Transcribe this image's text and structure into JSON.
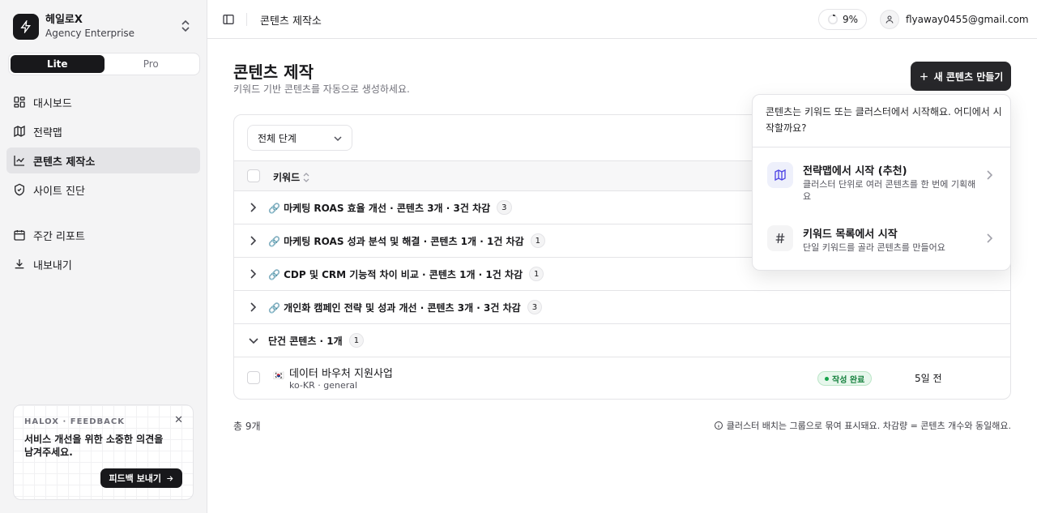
{
  "sidebar": {
    "org_name": "헤일로X",
    "org_plan": "Agency Enterprise",
    "modes": [
      "Lite",
      "Pro"
    ],
    "active_mode": "Lite",
    "nav": [
      {
        "label": "대시보드",
        "icon": "dashboard-icon"
      },
      {
        "label": "전략맵",
        "icon": "map-icon"
      },
      {
        "label": "콘텐츠 제작소",
        "icon": "chart-icon",
        "active": true
      },
      {
        "label": "사이트 진단",
        "icon": "shield-icon"
      }
    ],
    "nav2": [
      {
        "label": "주간 리포트",
        "icon": "calendar-icon"
      },
      {
        "label": "내보내기",
        "icon": "download-icon"
      }
    ],
    "feedback": {
      "eyebrow": "HALOX · FEEDBACK",
      "text": "서비스 개선을 위한 소중한 의견을 남겨주세요.",
      "button": "피드백 보내기"
    }
  },
  "topbar": {
    "title": "콘텐츠 제작소",
    "progress": "9%",
    "progress_value": 0.09,
    "email": "flyaway0455@gmail.com"
  },
  "main": {
    "title": "콘텐츠 제작",
    "subtitle": "키워드 기반 콘텐츠를 자동으로 생성하세요.",
    "new_button": "새 콘텐츠 만들기",
    "filter": "전체 단계",
    "column_keyword": "키워드",
    "groups": [
      {
        "label": "🔗 마케팅 ROAS 효율 개선 · 콘텐츠 3개 · 3건 차감",
        "count": "3",
        "expanded": false
      },
      {
        "label": "🔗 마케팅 ROAS 성과 분석 및 해결 · 콘텐츠 1개 · 1건 차감",
        "count": "1",
        "expanded": false
      },
      {
        "label": "🔗 CDP 및 CRM 기능적 차이 비교 · 콘텐츠 1개 · 1건 차감",
        "count": "1",
        "expanded": false
      },
      {
        "label": "🔗 개인화 캠페인 전략 및 성과 개선 · 콘텐츠 3개 · 3건 차감",
        "count": "3",
        "expanded": false
      },
      {
        "label": "단건 콘텐츠 · 1개",
        "count": "1",
        "expanded": true
      }
    ],
    "item": {
      "flag": "🇰🇷",
      "title": "데이터 바우처 지원사업",
      "meta": "ko-KR · general",
      "status": "작성 완료",
      "time": "5일 전"
    },
    "total": "총 9개",
    "note": "클러스터 배치는 그룹으로 묶여 표시돼요. 차감량 = 콘텐츠 개수와 동일해요."
  },
  "popover": {
    "intro": "콘텐츠는 키워드 또는 클러스터에서 시작해요. 어디에서 시작할까요?",
    "options": [
      {
        "title": "전략맵에서 시작 (추천)",
        "desc": "클러스터 단위로 여러 콘텐츠를 한 번에 기획해요"
      },
      {
        "title": "키워드 목록에서 시작",
        "desc": "단일 키워드를 골라 콘텐츠를 만들어요"
      }
    ]
  },
  "colors": {
    "dark": "#18181b",
    "success": "#15803d",
    "accent_soft": "#eef0fb"
  }
}
